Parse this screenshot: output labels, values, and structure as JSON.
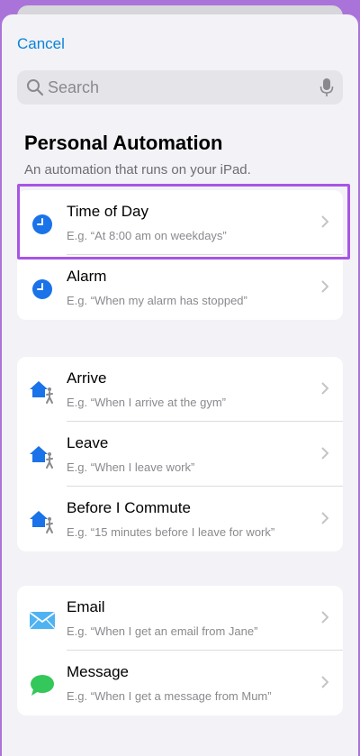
{
  "header": {
    "cancel_label": "Cancel"
  },
  "search": {
    "placeholder": "Search"
  },
  "page": {
    "title": "Personal Automation",
    "subtitle": "An automation that runs on your iPad."
  },
  "groups": [
    {
      "items": [
        {
          "label": "Time of Day",
          "example": "E.g. “At 8:00 am on weekdays”",
          "icon": "clock-icon"
        },
        {
          "label": "Alarm",
          "example": "E.g. “When my alarm has stopped”",
          "icon": "clock-icon"
        }
      ]
    },
    {
      "items": [
        {
          "label": "Arrive",
          "example": "E.g. “When I arrive at the gym”",
          "icon": "home-person-icon"
        },
        {
          "label": "Leave",
          "example": "E.g. “When I leave work”",
          "icon": "home-person-icon"
        },
        {
          "label": "Before I Commute",
          "example": "E.g. “15 minutes before I leave for work”",
          "icon": "home-person-icon"
        }
      ]
    },
    {
      "items": [
        {
          "label": "Email",
          "example": "E.g. “When I get an email from Jane”",
          "icon": "mail-icon"
        },
        {
          "label": "Message",
          "example": "E.g. “When I get a message from Mum”",
          "icon": "message-icon"
        }
      ]
    }
  ],
  "colors": {
    "accent": "#0a84d6",
    "clock": "#1a73e8",
    "highlight": "#a855e6",
    "message": "#34c759"
  }
}
